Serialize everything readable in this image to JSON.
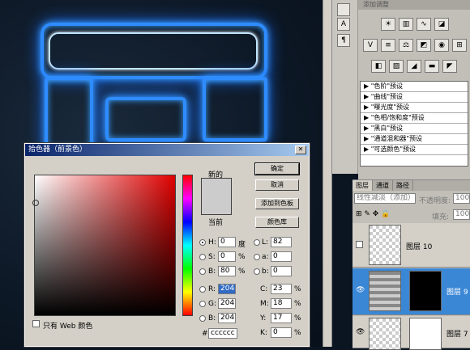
{
  "adjustments": {
    "title": "添加调整",
    "presets": [
      "\"色阶\"预设",
      "\"曲线\"预设",
      "\"曝光度\"预设",
      "\"色相/饱和度\"预设",
      "\"黑白\"预设",
      "\"通道混和器\"预设",
      "\"可选颜色\"预设"
    ]
  },
  "layers_panel": {
    "tabs": [
      "图层",
      "通道",
      "路径"
    ],
    "blend_mode": "线性减淡（添加）",
    "opacity_label": "不透明度:",
    "opacity": "100%",
    "fill_label": "填充:",
    "fill": "100%",
    "layers": [
      {
        "name": "图层 10",
        "selected": false
      },
      {
        "name": "图层 9",
        "selected": true
      },
      {
        "name": "图层 7",
        "selected": false
      }
    ]
  },
  "color_picker": {
    "title": "拾色器（前景色）",
    "new_label": "新的",
    "current_label": "当前",
    "buttons": {
      "ok": "确定",
      "cancel": "取消",
      "add_swatch": "添加到色板",
      "libraries": "颜色库"
    },
    "hsb": {
      "H": "0",
      "S": "0",
      "B": "80"
    },
    "hsb_units": {
      "H": "度",
      "S": "%",
      "B": "%"
    },
    "rgb": {
      "R": "204",
      "G": "204",
      "B": "204"
    },
    "lab": {
      "L": "82",
      "a": "0",
      "b": "0"
    },
    "cmyk": {
      "C": "23",
      "M": "18",
      "Y": "17",
      "K": "0"
    },
    "hex": "cccccc",
    "web_only_label": "只有 Web 颜色",
    "current_color": "#cccccc"
  }
}
